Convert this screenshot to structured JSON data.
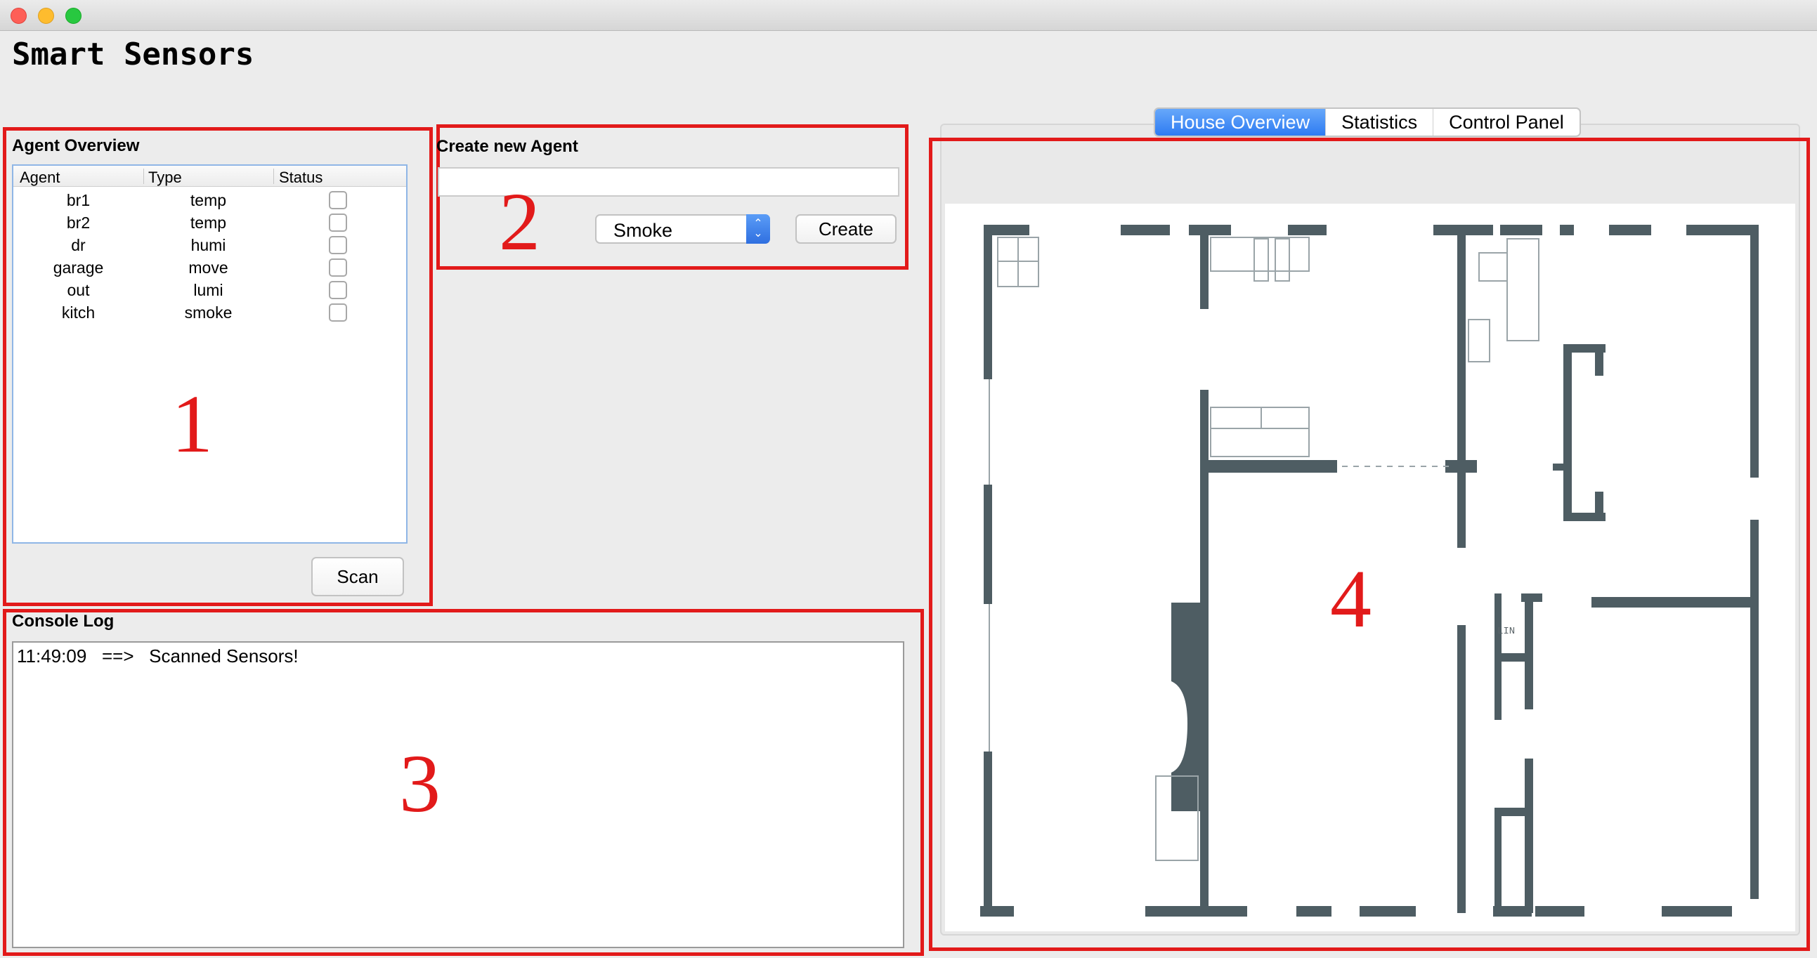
{
  "window": {
    "title": ""
  },
  "app": {
    "title": "Smart Sensors"
  },
  "agent_overview": {
    "title": "Agent Overview",
    "columns": [
      "Agent",
      "Type",
      "Status"
    ],
    "rows": [
      {
        "agent": "br1",
        "type": "temp",
        "status": false
      },
      {
        "agent": "br2",
        "type": "temp",
        "status": false
      },
      {
        "agent": "dr",
        "type": "humi",
        "status": false
      },
      {
        "agent": "garage",
        "type": "move",
        "status": false
      },
      {
        "agent": "out",
        "type": "lumi",
        "status": false
      },
      {
        "agent": "kitch",
        "type": "smoke",
        "status": false
      }
    ],
    "scan_label": "Scan",
    "marker": "1"
  },
  "create_agent": {
    "title": "Create new Agent",
    "name_value": "",
    "type_selected": "Smoke",
    "create_label": "Create",
    "marker": "2"
  },
  "console": {
    "title": "Console Log",
    "lines": [
      "11:49:09   ==>   Scanned Sensors!"
    ],
    "marker": "3"
  },
  "tabs": {
    "items": [
      "House Overview",
      "Statistics",
      "Control Panel"
    ],
    "active": 0,
    "marker": "4"
  },
  "colors": {
    "annotation_red": "#e21a1a",
    "tab_active": "#2e7bf2",
    "wall": "#4a5a60"
  },
  "icons": {
    "select_arrows": "chevron-up-down-icon",
    "status_checkbox": "checkbox-icon"
  }
}
